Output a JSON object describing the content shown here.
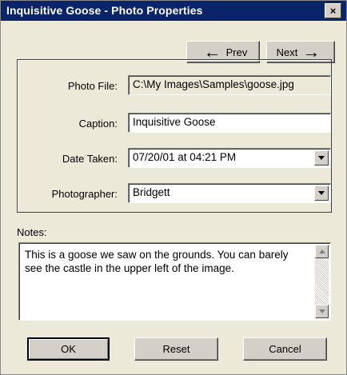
{
  "window": {
    "title": "Inquisitive Goose - Photo Properties",
    "close_glyph": "×"
  },
  "nav": {
    "prev_label": "Prev",
    "next_label": "Next"
  },
  "fields": {
    "photo_file": {
      "label": "Photo File:",
      "value": "C:\\My Images\\Samples\\goose.jpg"
    },
    "caption": {
      "label": "Caption:",
      "value": "Inquisitive Goose"
    },
    "date_taken": {
      "label": "Date Taken:",
      "value": "07/20/01 at 04:21 PM"
    },
    "photographer": {
      "label": "Photographer:",
      "value": "Bridgett"
    }
  },
  "notes": {
    "label": "Notes:",
    "value": "This is a goose we saw on the grounds.  You can barely see the castle in the upper left of the image."
  },
  "buttons": {
    "ok": "OK",
    "reset": "Reset",
    "cancel": "Cancel"
  },
  "icons": {
    "close": "close-icon",
    "prev": "arrow-left-icon",
    "next": "arrow-right-icon",
    "dropdown": "chevron-down-icon",
    "scroll_up": "scroll-up-icon",
    "scroll_down": "scroll-down-icon"
  }
}
